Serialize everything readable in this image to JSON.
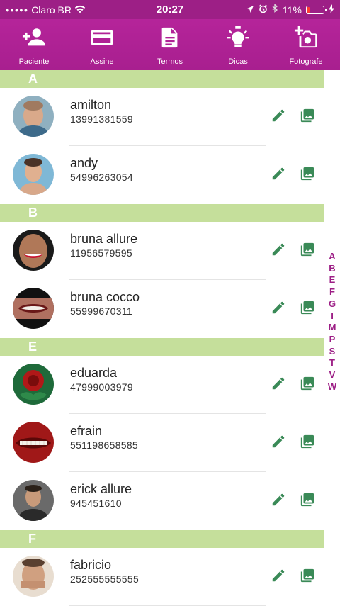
{
  "status_bar": {
    "carrier": "Claro BR",
    "time": "20:27",
    "battery": "11%"
  },
  "toolbar": {
    "items": [
      {
        "label": "Paciente",
        "icon": "add-person-icon"
      },
      {
        "label": "Assine",
        "icon": "credit-card-icon"
      },
      {
        "label": "Termos",
        "icon": "document-icon"
      },
      {
        "label": "Dicas",
        "icon": "lightbulb-icon"
      },
      {
        "label": "Fotografe",
        "icon": "add-photo-icon"
      }
    ]
  },
  "sections": [
    {
      "letter": "A",
      "contacts": [
        {
          "name": "amilton",
          "phone": "13991381559"
        },
        {
          "name": "andy",
          "phone": "54996263054"
        }
      ]
    },
    {
      "letter": "B",
      "contacts": [
        {
          "name": "bruna allure",
          "phone": "11956579595"
        },
        {
          "name": "bruna cocco",
          "phone": "55999670311"
        }
      ]
    },
    {
      "letter": "E",
      "contacts": [
        {
          "name": "eduarda",
          "phone": "47999003979"
        },
        {
          "name": "efrain",
          "phone": "551198658585"
        },
        {
          "name": "erick allure",
          "phone": "945451610"
        }
      ]
    },
    {
      "letter": "F",
      "contacts": [
        {
          "name": "fabricio",
          "phone": "252555555555"
        }
      ]
    }
  ],
  "alpha_index": [
    "A",
    "B",
    "E",
    "F",
    "G",
    "I",
    "M",
    "P",
    "S",
    "T",
    "V",
    "W"
  ],
  "colors": {
    "primary": "#a81f8f",
    "section_header": "#c5df9b",
    "action_icon": "#3a8a57"
  }
}
